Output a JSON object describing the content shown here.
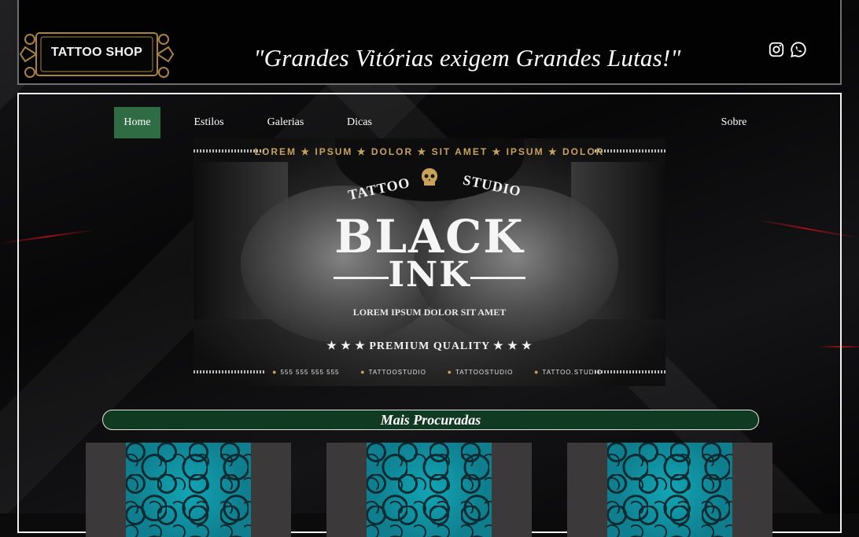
{
  "header": {
    "logo_text": "TATTOO SHOP",
    "slogan": "\"Grandes Vitórias exigem Grandes Lutas!\"",
    "social": [
      "instagram-icon",
      "whatsapp-icon"
    ]
  },
  "nav": {
    "items": [
      {
        "label": "Home",
        "active": true
      },
      {
        "label": "Estilos"
      },
      {
        "label": "Galerias"
      },
      {
        "label": "Dicas"
      },
      {
        "label": "Sobre"
      }
    ]
  },
  "banner": {
    "top_text": "LOREM ★ IPSUM ★ DOLOR ★ SIT AMET ★ IPSUM ★ DOLOR",
    "tattoo": "TATTOO",
    "studio": "STUDIO",
    "black": "BLACK",
    "ink": "INK",
    "lorem": "LOREM IPSUM DOLOR SIT AMET",
    "premium": "★ ★ ★ PREMIUM QUALITY ★ ★ ★",
    "contacts": [
      "555 555 555 555",
      "TATTOOSTUDIO",
      "TATTOOSTUDIO",
      "TATTOO.STUDIO"
    ]
  },
  "section": {
    "title": "Mais Procuradas"
  },
  "colors": {
    "nav_active": "#2f6c44",
    "section_bg": "#113a22",
    "gold": "#c9a25a"
  }
}
